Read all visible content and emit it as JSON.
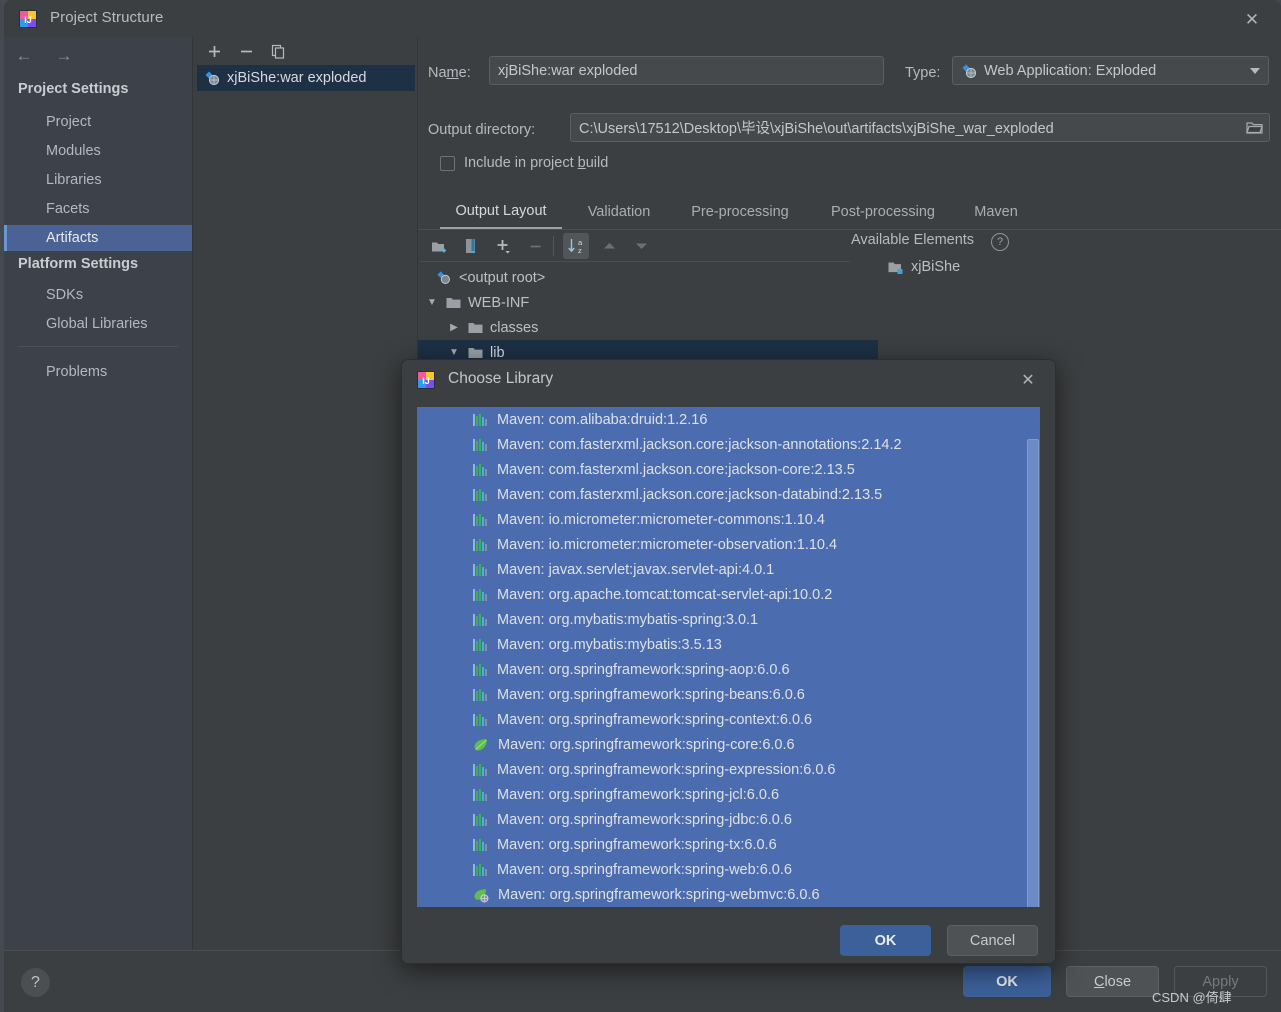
{
  "window": {
    "title": "Project Structure",
    "close_label": "✕",
    "app_icon": "intellij-idea-icon"
  },
  "sidebar": {
    "nav": {
      "back": "←",
      "forward": "→"
    },
    "groups": [
      {
        "label": "Project Settings",
        "items": [
          {
            "label": "Project",
            "selected": false
          },
          {
            "label": "Modules",
            "selected": false
          },
          {
            "label": "Libraries",
            "selected": false
          },
          {
            "label": "Facets",
            "selected": false
          },
          {
            "label": "Artifacts",
            "selected": true
          }
        ]
      },
      {
        "label": "Platform Settings",
        "items": [
          {
            "label": "SDKs",
            "selected": false
          },
          {
            "label": "Global Libraries",
            "selected": false
          }
        ]
      }
    ],
    "problems": {
      "label": "Problems"
    }
  },
  "artifacts_panel": {
    "toolbar": [
      {
        "name": "add-artifact-button",
        "glyph": "+"
      },
      {
        "name": "remove-artifact-button",
        "glyph": "−"
      },
      {
        "name": "copy-artifact-button",
        "glyph": "copy-icon"
      }
    ],
    "items": [
      {
        "label": "xjBiShe:war exploded",
        "icon": "artifact-icon",
        "selected": true
      }
    ]
  },
  "detail": {
    "name_label": "Name:",
    "name_value": "xjBiShe:war exploded",
    "type_label": "Type:",
    "type_value": "Web Application: Exploded",
    "type_icon": "artifact-icon",
    "output_dir_label": "Output directory:",
    "output_dir_value": "C:\\Users\\17512\\Desktop\\毕设\\xjBiShe\\out\\artifacts\\xjBiShe_war_exploded",
    "browse_icon": "folder-open-icon",
    "include_checkbox": {
      "label_pre": "Include in project ",
      "label_accel": "b",
      "label_post": "uild",
      "checked": false
    },
    "tabs": [
      {
        "label": "Output Layout",
        "active": true
      },
      {
        "label": "Validation",
        "active": false
      },
      {
        "label": "Pre-processing",
        "active": false
      },
      {
        "label": "Post-processing",
        "active": false
      },
      {
        "label": "Maven",
        "active": false
      }
    ],
    "layout_toolbar": [
      {
        "name": "create-directory-button",
        "icon": "new-folder-icon"
      },
      {
        "name": "create-archive-button",
        "icon": "archive-icon"
      },
      {
        "name": "add-copy-of-button",
        "icon": "plus-dropdown-icon"
      },
      {
        "name": "remove-button",
        "icon": "minus-icon"
      },
      {
        "name": "sort-by-type-button",
        "icon": "sort-az-icon",
        "toggled": true
      },
      {
        "name": "move-up-button",
        "icon": "arrow-up-icon"
      },
      {
        "name": "move-down-button",
        "icon": "arrow-down-icon"
      }
    ],
    "tree": [
      {
        "label": "<output root>",
        "indent": 0,
        "icon": "artifact-icon",
        "twisty": "none",
        "selected": false
      },
      {
        "label": "WEB-INF",
        "indent": 1,
        "icon": "folder-icon",
        "twisty": "expanded",
        "selected": false
      },
      {
        "label": "classes",
        "indent": 2,
        "icon": "folder-icon",
        "twisty": "collapsed",
        "selected": false
      },
      {
        "label": "lib",
        "indent": 2,
        "icon": "folder-icon",
        "twisty": "expanded",
        "selected": true
      }
    ],
    "available_elements": {
      "title": "Available Elements",
      "help_glyph": "?",
      "items": [
        {
          "label": "xjBiShe",
          "icon": "module-folder-icon"
        }
      ]
    }
  },
  "footer": {
    "help_glyph": "?",
    "ok_label": "OK",
    "close_label": "Close",
    "apply_label": "Apply",
    "apply_enabled": false
  },
  "watermark": "CSDN @倚肆",
  "choose_library_dialog": {
    "title": "Choose Library",
    "app_icon": "intellij-idea-icon",
    "close_label": "✕",
    "ok_label": "OK",
    "cancel_label": "Cancel",
    "all_selected": true,
    "items": [
      {
        "label": "Maven: com.alibaba:druid:1.2.16",
        "icon": "maven-icon"
      },
      {
        "label": "Maven: com.fasterxml.jackson.core:jackson-annotations:2.14.2",
        "icon": "maven-icon"
      },
      {
        "label": "Maven: com.fasterxml.jackson.core:jackson-core:2.13.5",
        "icon": "maven-icon"
      },
      {
        "label": "Maven: com.fasterxml.jackson.core:jackson-databind:2.13.5",
        "icon": "maven-icon"
      },
      {
        "label": "Maven: io.micrometer:micrometer-commons:1.10.4",
        "icon": "maven-icon"
      },
      {
        "label": "Maven: io.micrometer:micrometer-observation:1.10.4",
        "icon": "maven-icon"
      },
      {
        "label": "Maven: javax.servlet:javax.servlet-api:4.0.1",
        "icon": "maven-icon"
      },
      {
        "label": "Maven: org.apache.tomcat:tomcat-servlet-api:10.0.2",
        "icon": "maven-icon"
      },
      {
        "label": "Maven: org.mybatis:mybatis-spring:3.0.1",
        "icon": "maven-icon"
      },
      {
        "label": "Maven: org.mybatis:mybatis:3.5.13",
        "icon": "maven-icon"
      },
      {
        "label": "Maven: org.springframework:spring-aop:6.0.6",
        "icon": "maven-icon"
      },
      {
        "label": "Maven: org.springframework:spring-beans:6.0.6",
        "icon": "maven-icon"
      },
      {
        "label": "Maven: org.springframework:spring-context:6.0.6",
        "icon": "maven-icon"
      },
      {
        "label": "Maven: org.springframework:spring-core:6.0.6",
        "icon": "spring-leaf-icon"
      },
      {
        "label": "Maven: org.springframework:spring-expression:6.0.6",
        "icon": "maven-icon"
      },
      {
        "label": "Maven: org.springframework:spring-jcl:6.0.6",
        "icon": "maven-icon"
      },
      {
        "label": "Maven: org.springframework:spring-jdbc:6.0.6",
        "icon": "maven-icon"
      },
      {
        "label": "Maven: org.springframework:spring-tx:6.0.6",
        "icon": "maven-icon"
      },
      {
        "label": "Maven: org.springframework:spring-web:6.0.6",
        "icon": "maven-icon"
      },
      {
        "label": "Maven: org.springframework:spring-webmvc:6.0.6",
        "icon": "spring-mvc-leaf-icon"
      }
    ]
  },
  "colors": {
    "window_bg": "#3c3f41",
    "sidebar_bg": "#3c414a",
    "selection_blue": "#4a6294",
    "tree_selection": "#1d3044",
    "list_selection": "#4c6cb0",
    "primary_button": "#3c6099"
  }
}
